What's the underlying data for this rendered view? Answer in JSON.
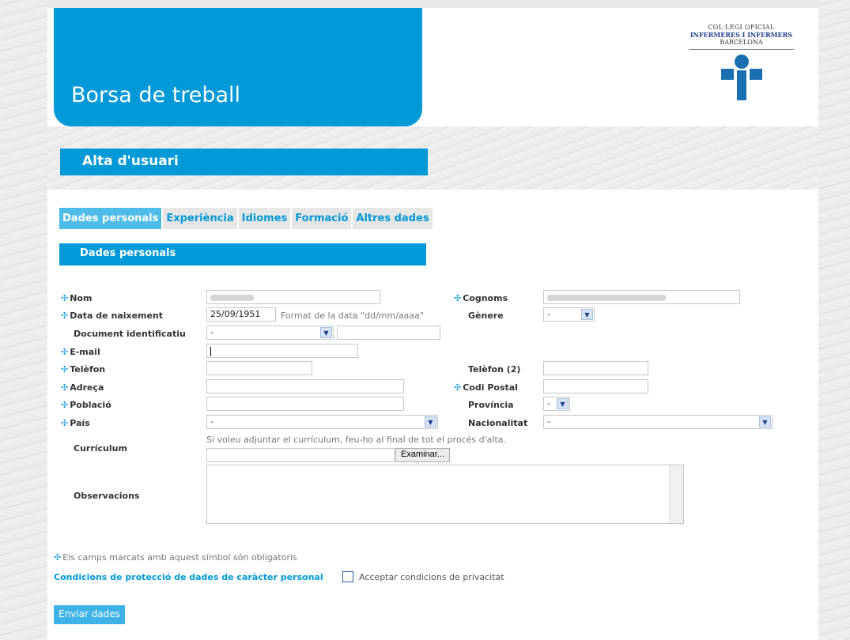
{
  "header": {
    "banner_title": "Borsa de treball",
    "logo": {
      "line1": "COL·LEGI OFICIAL",
      "line2": "INFERMERES I INFERMERS",
      "line3": "BARCELONA"
    }
  },
  "page_title": "Alta d'usuari",
  "tabs": [
    {
      "label": "Dades personals",
      "active": true
    },
    {
      "label": "Experiència",
      "active": false
    },
    {
      "label": "Idiomes",
      "active": false
    },
    {
      "label": "Formació",
      "active": false
    },
    {
      "label": "Altres dades",
      "active": false
    }
  ],
  "section_title": "Dades personals",
  "required_marker": "✣",
  "form": {
    "nom": {
      "label": "Nom",
      "required": true
    },
    "cognoms": {
      "label": "Cognoms",
      "required": true
    },
    "data_naixement": {
      "label": "Data de naixement",
      "required": true,
      "value": "25/09/1951",
      "hint": "Format de la data \"dd/mm/aaaa\""
    },
    "genere": {
      "label": "Gènere",
      "required": false,
      "value": "-"
    },
    "document": {
      "label": "Document identificatiu",
      "required": false,
      "value": "-"
    },
    "email": {
      "label": "E-mail",
      "required": true
    },
    "telefon": {
      "label": "Telèfon",
      "required": true
    },
    "telefon2": {
      "label": "Telèfon (2)",
      "required": false
    },
    "adreca": {
      "label": "Adreça",
      "required": true
    },
    "codi_postal": {
      "label": "Codi Postal",
      "required": true
    },
    "poblacio": {
      "label": "Població",
      "required": true
    },
    "provincia": {
      "label": "Província",
      "required": false,
      "value": "-"
    },
    "pais": {
      "label": "País",
      "required": true,
      "value": "-"
    },
    "nacionalitat": {
      "label": "Nacionalitat",
      "required": false,
      "value": "-"
    },
    "curriculum": {
      "label": "Currículum",
      "hint": "Si voleu adjuntar el currículum, feu-ho al final de tot el procés d'alta.",
      "browse_label": "Examinar..."
    },
    "observacions": {
      "label": "Observacions"
    }
  },
  "required_note": "Els camps marcats amb aquest símbol són obligatoris",
  "privacy": {
    "link": "Condicions de protecció de dades de caràcter personal",
    "checkbox_label": "Acceptar condicions de privacitat"
  },
  "submit_label": "Enviar dades",
  "colors": {
    "brand_blue": "#0099d8",
    "active_tab": "#4dbce9"
  },
  "icons": {
    "required": "required-marker-icon",
    "select_arrow": "chevron-down-icon",
    "logo": "cross-logo-icon"
  }
}
